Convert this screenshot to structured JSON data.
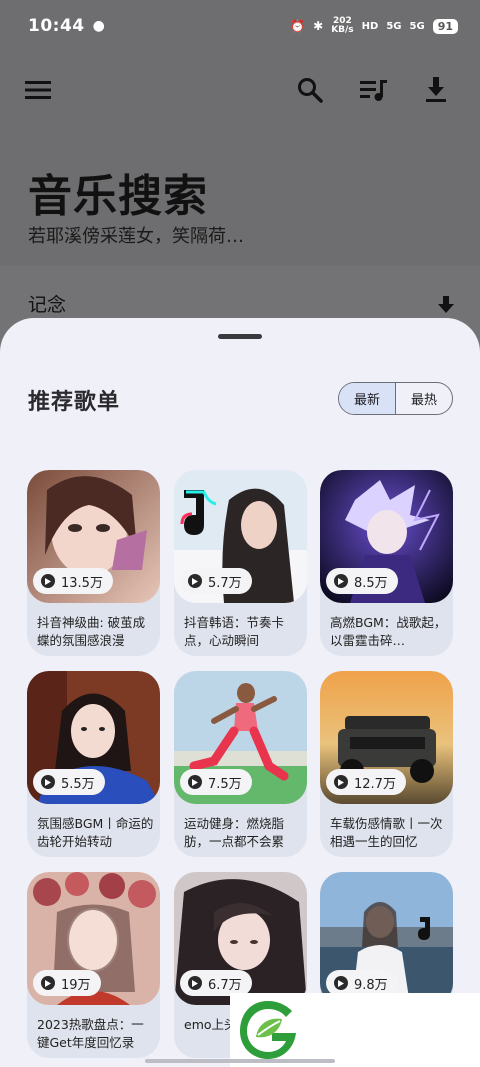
{
  "status_bar": {
    "time": "10:44",
    "speed_top": "202",
    "speed_bottom": "KB/s",
    "hd": "HD",
    "net1": "5G",
    "net2": "5G",
    "battery": "91"
  },
  "toolbar": {
    "menu_icon": "menu-icon",
    "search_icon": "search-icon",
    "playlist_icon": "playlist-icon",
    "download_icon": "download-icon"
  },
  "header": {
    "title": "音乐搜索",
    "subtitle": "若耶溪傍采莲女，笑隔荷…"
  },
  "below_header": {
    "label": "记念"
  },
  "sheet": {
    "title": "推荐歌单",
    "tabs": [
      {
        "label": "最新",
        "active": true
      },
      {
        "label": "最热",
        "active": false
      }
    ]
  },
  "playlists": [
    {
      "count": "13.5万",
      "name": "抖音神级曲: 破茧成蝶的氛围感浪漫"
    },
    {
      "count": "5.7万",
      "name": "抖音韩语：节奏卡点，心动瞬间"
    },
    {
      "count": "8.5万",
      "name": "高燃BGM：战歌起，以雷霆击碎…"
    },
    {
      "count": "5.5万",
      "name": "氛围感BGM丨命运的齿轮开始转动"
    },
    {
      "count": "7.5万",
      "name": "运动健身：燃烧脂肪，一点都不会累"
    },
    {
      "count": "12.7万",
      "name": "车载伤感情歌丨一次相遇一生的回忆"
    },
    {
      "count": "19万",
      "name": "2023热歌盘点：一键Get年度回忆录"
    },
    {
      "count": "6.7万",
      "name": "emo上头：停键吧我"
    },
    {
      "count": "9.8万",
      "name": ""
    }
  ],
  "colors": {
    "scrim": "#6e6e70",
    "sheet_bg": "#f0f1f8",
    "card_bg": "#dfe3ed",
    "tab_active": "#d9e1f6",
    "logo_green": "#2e9e3a"
  }
}
